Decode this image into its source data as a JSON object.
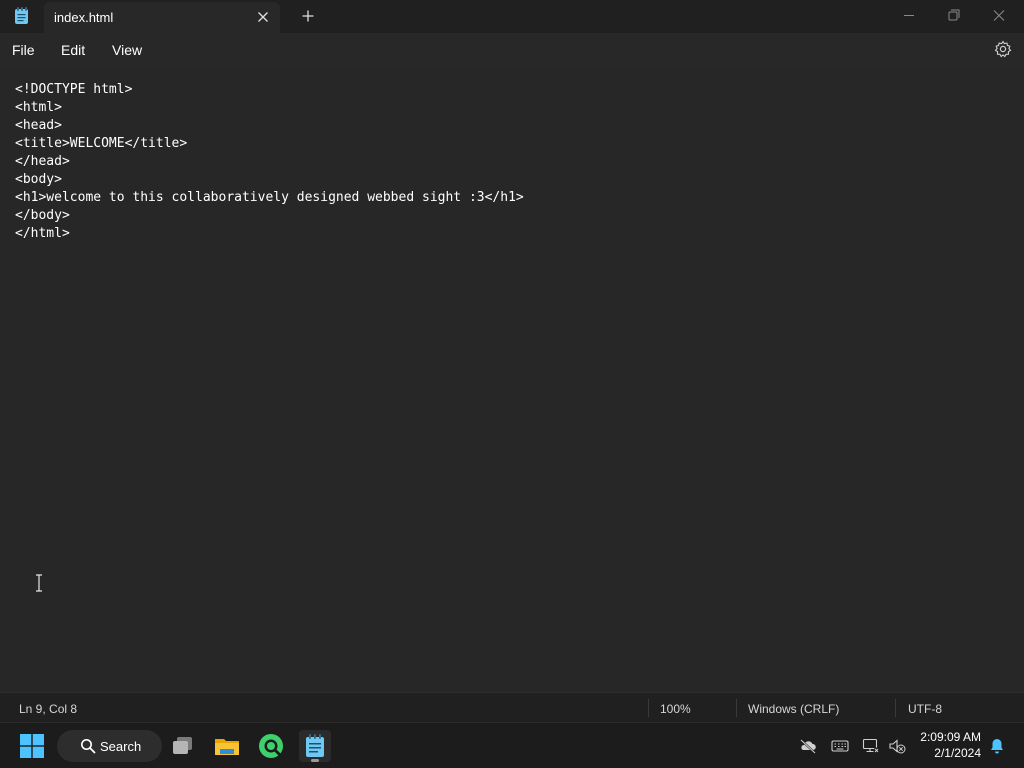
{
  "window": {
    "tab_title": "index.html"
  },
  "menu": {
    "file": "File",
    "edit": "Edit",
    "view": "View"
  },
  "editor": {
    "lines": [
      "<!DOCTYPE html>",
      "<html>",
      "<head>",
      "<title>WELCOME</title>",
      "</head>",
      "<body>",
      "<h1>welcome to this collaboratively designed webbed sight :3</h1>",
      "</body>",
      "</html>"
    ]
  },
  "status": {
    "position": "Ln 9, Col 8",
    "zoom": "100%",
    "line_ending": "Windows (CRLF)",
    "encoding": "UTF-8"
  },
  "taskbar": {
    "search_label": "Search",
    "time": "2:09:09 AM",
    "date": "2/1/2024"
  },
  "colors": {
    "accent": "#4cc2ff",
    "notepad_icon": "#6fc8f2",
    "folder": "#f7c337",
    "browser": "#3dd06c"
  }
}
